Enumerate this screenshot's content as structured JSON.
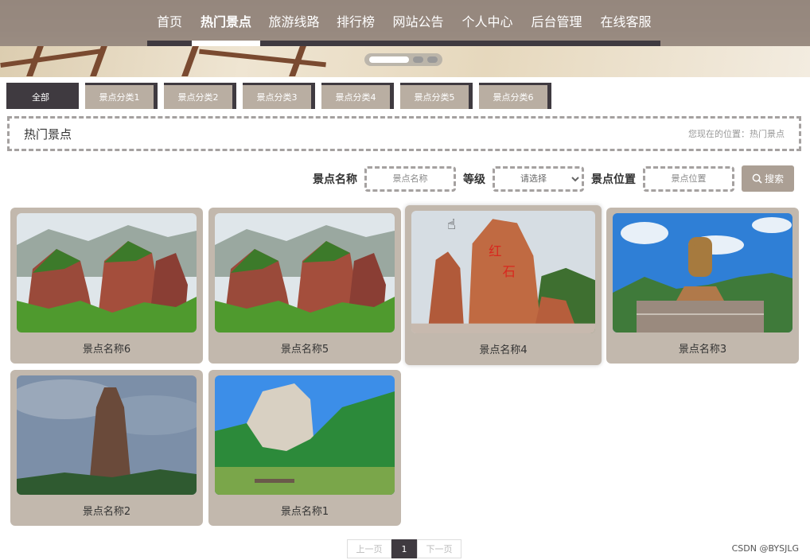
{
  "nav": {
    "items": [
      "首页",
      "热门景点",
      "旅游线路",
      "排行榜",
      "网站公告",
      "个人中心",
      "后台管理",
      "在线客服"
    ],
    "active": "热门景点"
  },
  "tabs": [
    "全部",
    "景点分类1",
    "景点分类2",
    "景点分类3",
    "景点分类4",
    "景点分类5",
    "景点分类6"
  ],
  "crumb": {
    "title": "热门景点",
    "position": "您现在的位置：热门景点"
  },
  "search": {
    "name_label": "景点名称",
    "name_placeholder": "景点名称",
    "level_label": "等级",
    "level_selected": "请选择",
    "location_label": "景点位置",
    "location_placeholder": "景点位置",
    "button_label": "搜索"
  },
  "cards": [
    {
      "name": "景点名称6",
      "image": "red-cliff-mountains"
    },
    {
      "name": "景点名称5",
      "image": "red-cliff-mountains"
    },
    {
      "name": "景点名称4",
      "image": "red-rock-monument"
    },
    {
      "name": "景点名称3",
      "image": "giant-buddha-statue"
    },
    {
      "name": "景点名称2",
      "image": "stone-pillar"
    },
    {
      "name": "景点名称1",
      "image": "river-cliff-bamboo-raft"
    }
  ],
  "pager": {
    "prev": "上一页",
    "current": "1",
    "next": "下一页"
  },
  "watermark": "CSDN @BYSJLG"
}
